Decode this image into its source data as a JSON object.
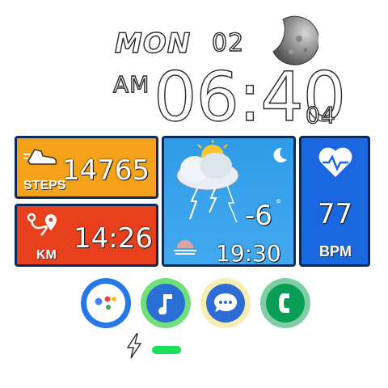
{
  "header": {
    "day": "MON",
    "date": "02",
    "am_pm": "AM",
    "time": "06:40",
    "seconds": "04"
  },
  "steps": {
    "value": "14765",
    "label": "STEPS",
    "icon": "shoe-icon"
  },
  "distance": {
    "value": "14:26",
    "label": "KM",
    "icon": "route-icon"
  },
  "weather": {
    "temperature": "-6",
    "degree": "°",
    "time": "19:30",
    "icons": [
      "thunderstorm-cloud-icon",
      "moon-icon",
      "sunset-icon"
    ]
  },
  "heart_rate": {
    "value": "77",
    "label": "BPM",
    "icon": "heart-icon"
  },
  "apps": [
    {
      "name": "assistant",
      "icon": "assistant-icon"
    },
    {
      "name": "music",
      "icon": "music-note-icon"
    },
    {
      "name": "messages",
      "icon": "chat-bubble-icon"
    },
    {
      "name": "phone",
      "icon": "phone-icon"
    }
  ],
  "status": {
    "icon": "lightning-icon",
    "battery_level": 1.0,
    "battery_color": "#19e05a"
  },
  "colors": {
    "steps": "#f4a21a",
    "distance": "#e8401d",
    "weather": "#2f9be8",
    "heart_rate": "#1a67e0",
    "tile_border": "#0b2a5c"
  }
}
